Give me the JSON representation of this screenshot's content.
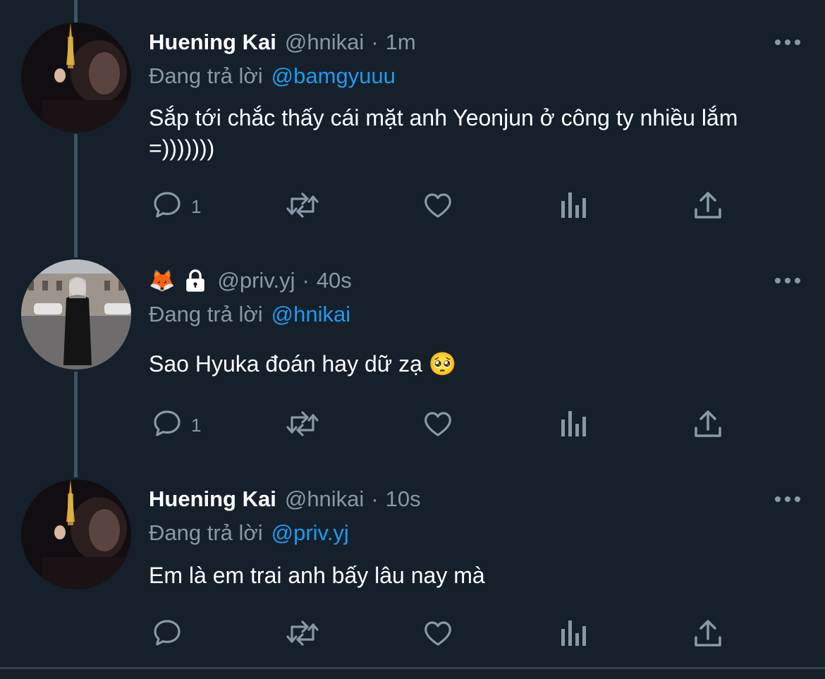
{
  "tweets": [
    {
      "name": "Huening Kai",
      "handle": "@hnikai",
      "separator": "·",
      "time": "1m",
      "reply_prefix": "Đang trả lời",
      "reply_to": "@bamgyuuu",
      "text": "Sắp tới chắc thấy cái mặt anh Yeonjun ở công ty nhiều lắm =)))))))",
      "reply_count": "1"
    },
    {
      "name_emoji": "🦊",
      "locked": true,
      "handle": "@priv.yj",
      "separator": "·",
      "time": "40s",
      "reply_prefix": "Đang trả lời",
      "reply_to": "@hnikai",
      "text": "Sao Hyuka đoán hay dữ zạ 🥺",
      "reply_count": "1"
    },
    {
      "name": "Huening Kai",
      "handle": "@hnikai",
      "separator": "·",
      "time": "10s",
      "reply_prefix": "Đang trả lời",
      "reply_to": "@priv.yj",
      "text": "Em là em trai anh bấy lâu nay mà",
      "reply_count": ""
    }
  ],
  "icons": [
    "reply-icon",
    "retweet-icon",
    "like-icon",
    "analytics-icon",
    "share-icon",
    "more-icon",
    "lock-icon"
  ],
  "colors": {
    "background": "#15202b",
    "secondary_text": "#8899a6",
    "link": "#1d9bf0",
    "thread_line": "#3d5466"
  }
}
